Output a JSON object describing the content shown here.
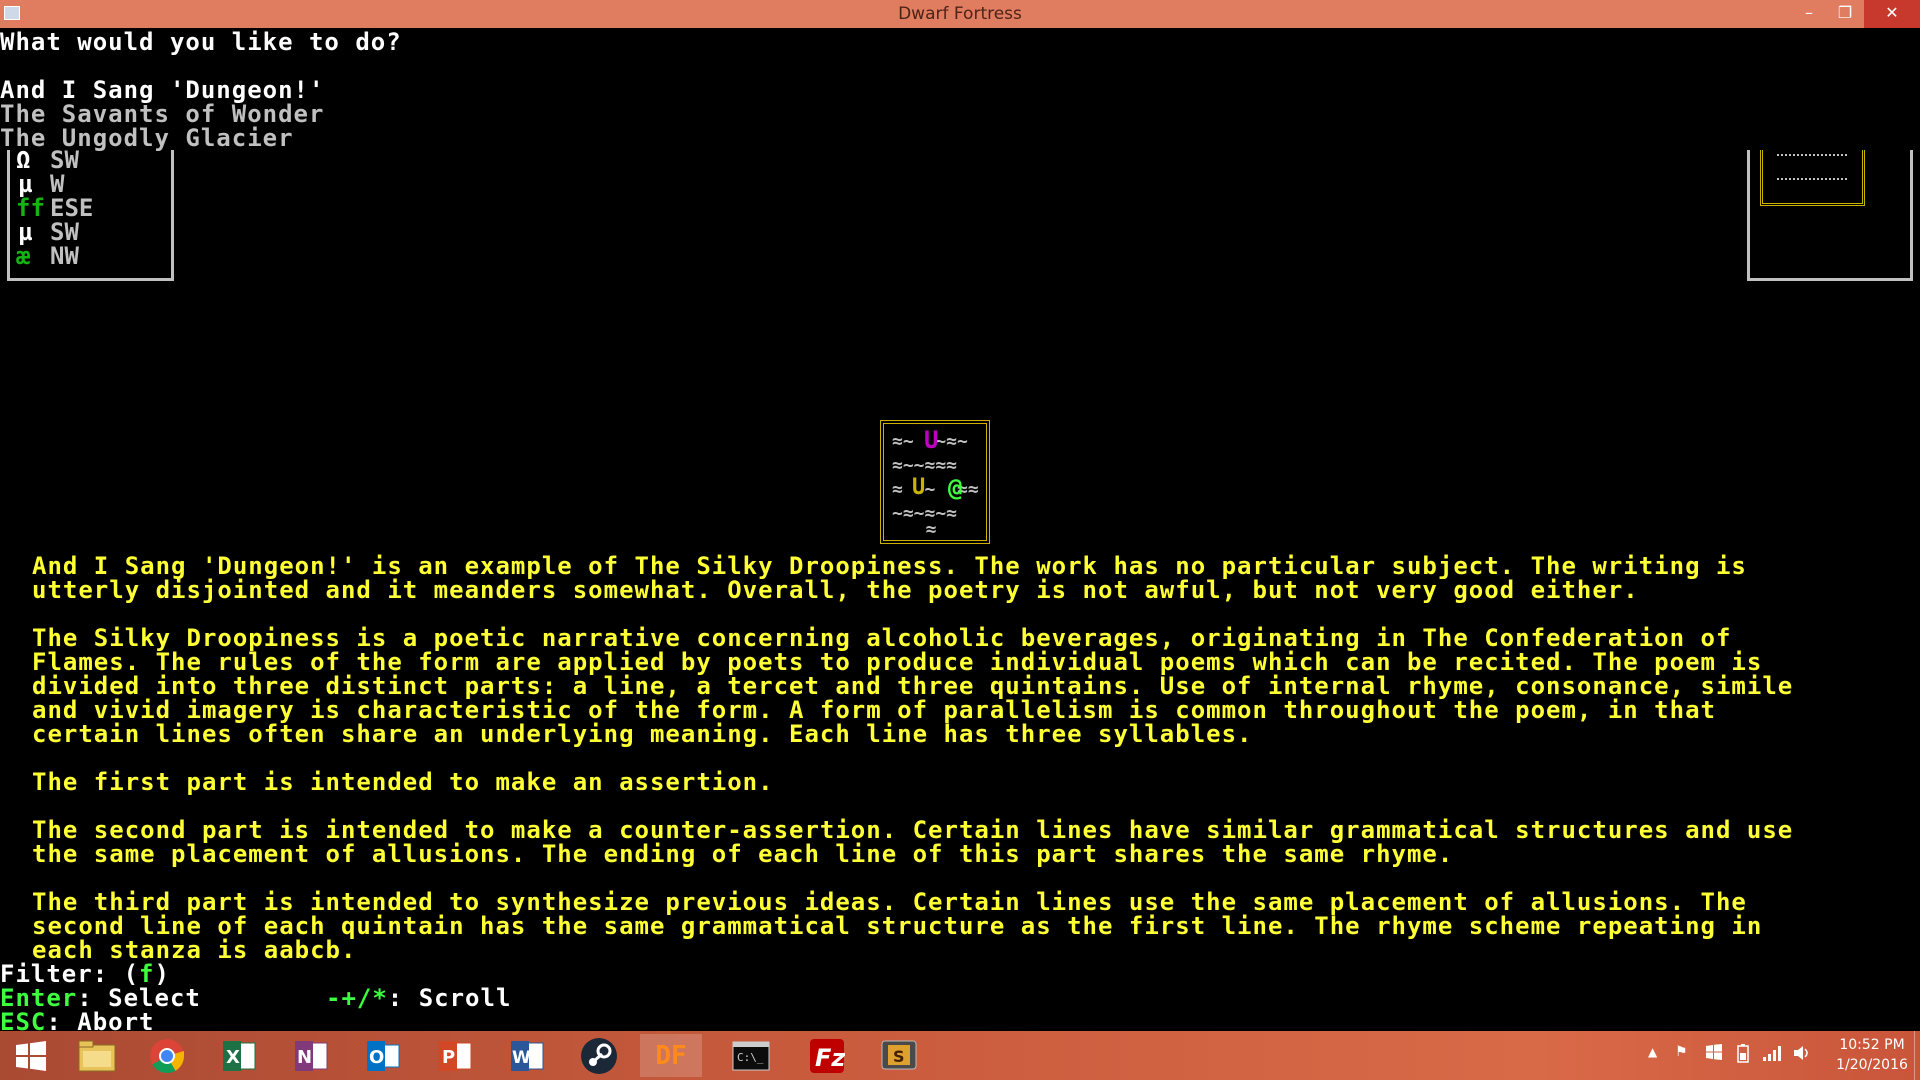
{
  "window": {
    "title": "Dwarf Fortress"
  },
  "menu": {
    "prompt": "What would you like to do?",
    "options": [
      "And I Sang 'Dungeon!'",
      "The Savants of Wonder",
      "The Ungodly Glacier"
    ]
  },
  "units_panel": {
    "rows": [
      {
        "glyph": "Ω",
        "dir": "SW"
      },
      {
        "glyph": "µ",
        "dir": "W"
      },
      {
        "glyph": "ff",
        "dir": "ESE"
      },
      {
        "glyph": "µ",
        "dir": "SW"
      },
      {
        "glyph": "æ",
        "dir": "NW"
      }
    ]
  },
  "description": {
    "lines": [
      "And I Sang 'Dungeon!' is an example of The Silky Droopiness. The work has no particular subject. The writing is",
      "utterly disjointed and it meanders somewhat. Overall, the poetry is not awful, but not very good either.",
      "",
      "The Silky Droopiness is a poetic narrative concerning alcoholic beverages, originating in The Confederation of",
      "Flames. The rules of the form are applied by poets to produce individual poems which can be recited. The poem is",
      "divided into three distinct parts: a line, a tercet and three quintains. Use of internal rhyme, consonance, simile",
      "and vivid imagery is characteristic of the form. A form of parallelism is common throughout the poem, in that",
      "certain lines often share an underlying meaning. Each line has three syllables.",
      "",
      "The first part is intended to make an assertion.",
      "",
      "The second part is intended to make a counter-assertion. Certain lines have similar grammatical structures and use",
      "the same placement of allusions. The ending of each line of this part shares the same rhyme.",
      "",
      "The third part is intended to synthesize previous ideas. Certain lines use the same placement of allusions. The",
      "second line of each quintain has the same grammatical structure as the first line. The rhyme scheme repeating in",
      "each stanza is aabcb."
    ]
  },
  "footer": {
    "filter_label": "Filter: (",
    "filter_key": "f",
    "filter_close": ")",
    "enter_key": "Enter",
    "enter_action": ": Select",
    "scroll_key": "-+/*",
    "scroll_action": ": Scroll",
    "esc_key": "ESC",
    "esc_action": ": Abort"
  },
  "map": {
    "glyph_a": "U",
    "glyph_b": "U",
    "glyph_c": "@"
  },
  "taskbar": {
    "apps": [
      "start",
      "file-explorer",
      "chrome",
      "excel",
      "onenote",
      "outlook",
      "powerpoint",
      "word",
      "steam",
      "dwarf-fortress",
      "terminal",
      "filezilla",
      "app-s"
    ],
    "df_label": "DF",
    "time": "10:52 PM",
    "date": "1/20/2016"
  }
}
